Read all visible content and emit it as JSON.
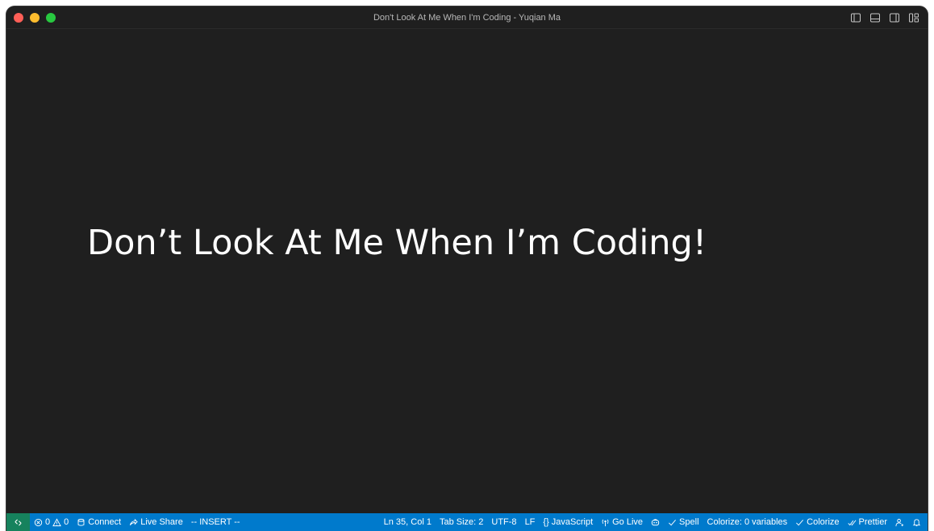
{
  "window": {
    "title": "Don't Look At Me When I'm Coding - Yuqian Ma",
    "traffic_colors": {
      "close": "#ff5f57",
      "minimize": "#febc2e",
      "maximize": "#28c840"
    }
  },
  "layout_icons": [
    "toggle-primary-sidebar-icon",
    "toggle-panel-icon",
    "toggle-secondary-sidebar-icon",
    "customize-layout-icon"
  ],
  "editor": {
    "heading": "Don’t Look At Me When I’m Coding!"
  },
  "statusbar": {
    "colors": {
      "background": "#007acc",
      "remote": "#16825d"
    },
    "left": {
      "remote_icon": "remote-icon",
      "errors": "0",
      "warnings": "0",
      "connect": "Connect",
      "live_share": "Live Share",
      "vim_mode": "-- INSERT --"
    },
    "right": {
      "position": "Ln 35, Col 1",
      "tab_size": "Tab Size: 2",
      "encoding": "UTF-8",
      "eol": "LF",
      "language_glyph": "{}",
      "language": "JavaScript",
      "go_live": "Go Live",
      "spell": "Spell",
      "colorize_vars": "Colorize: 0 variables",
      "colorize": "Colorize",
      "prettier": "Prettier"
    }
  }
}
